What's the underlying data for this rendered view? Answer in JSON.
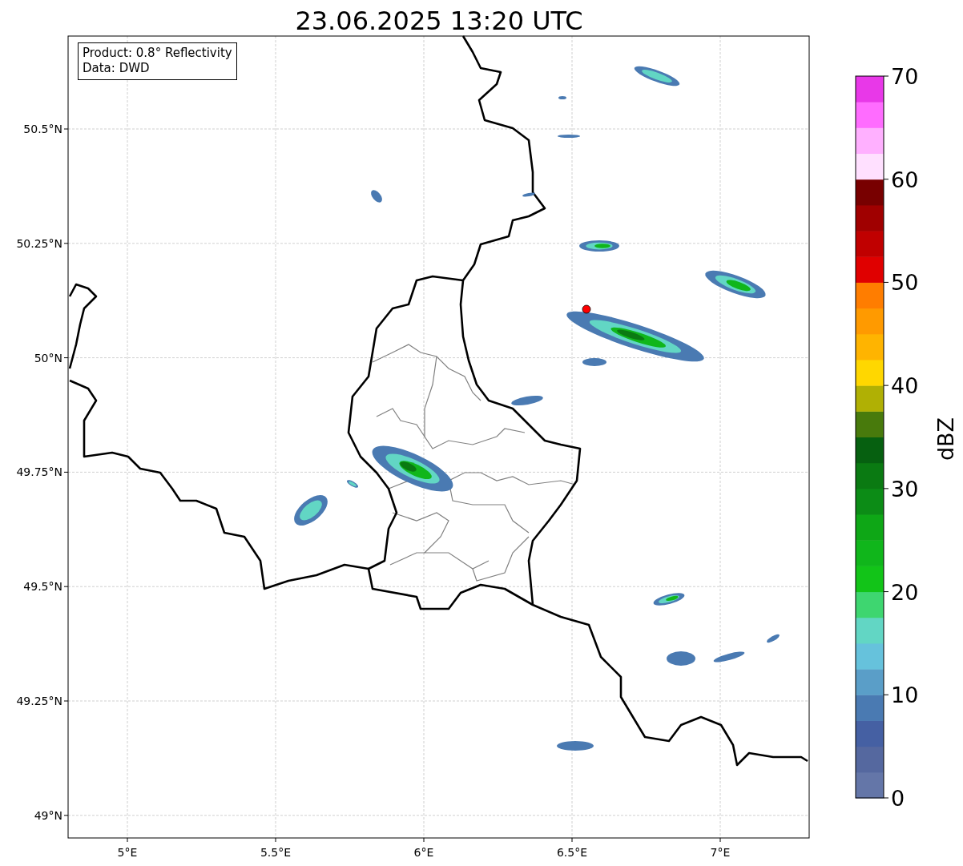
{
  "title": "23.06.2025 13:20 UTC",
  "info": [
    "Product: 0.8° Reflectivity",
    "Data: DWD"
  ],
  "map": {
    "x_ticks": [
      "5°E",
      "5.5°E",
      "6°E",
      "6.5°E",
      "7°E"
    ],
    "y_ticks": [
      "50.5°N",
      "50.25°N",
      "50°N",
      "49.75°N",
      "49.5°N",
      "49.25°N",
      "49°N"
    ]
  },
  "colorbar": {
    "label": "dBZ",
    "ticks": [
      "70",
      "60",
      "50",
      "40",
      "30",
      "20",
      "10",
      "0"
    ],
    "segments": [
      {
        "color": "#6476a8"
      },
      {
        "color": "#55689f"
      },
      {
        "color": "#4560a3"
      },
      {
        "color": "#4a7ab2"
      },
      {
        "color": "#5a9ec8"
      },
      {
        "color": "#66c2dc"
      },
      {
        "color": "#62d6c4"
      },
      {
        "color": "#3ed670"
      },
      {
        "color": "#12c418"
      },
      {
        "color": "#10b61b"
      },
      {
        "color": "#0ea716"
      },
      {
        "color": "#0c8c16"
      },
      {
        "color": "#0a7a12"
      },
      {
        "color": "#066010"
      },
      {
        "color": "#487a0c"
      },
      {
        "color": "#b0b004"
      },
      {
        "color": "#ffd700"
      },
      {
        "color": "#ffb400"
      },
      {
        "color": "#ff9a00"
      },
      {
        "color": "#ff7d00"
      },
      {
        "color": "#e00000"
      },
      {
        "color": "#c00000"
      },
      {
        "color": "#a00000"
      },
      {
        "color": "#780000"
      },
      {
        "color": "#ffe0ff"
      },
      {
        "color": "#ffb0ff"
      },
      {
        "color": "#ff6cff"
      },
      {
        "color": "#e838e8"
      }
    ]
  }
}
